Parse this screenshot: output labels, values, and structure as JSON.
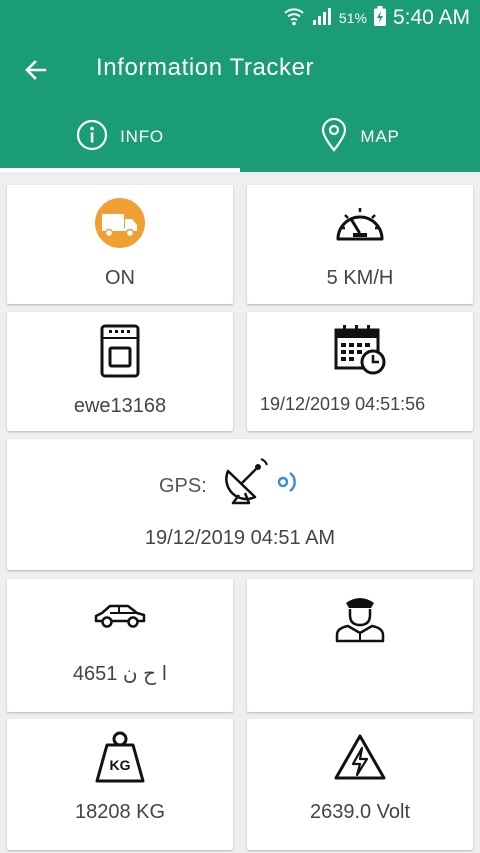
{
  "status_bar": {
    "battery_percent": "51%",
    "time": "5:40 AM",
    "icons": [
      "wifi-icon",
      "signal-icon",
      "battery-charging-icon"
    ]
  },
  "app_bar": {
    "title": "Information Tracker",
    "back_icon": "arrow-left-icon"
  },
  "tabs": [
    {
      "label": "INFO",
      "icon": "info-icon",
      "active": true
    },
    {
      "label": "MAP",
      "icon": "location-pin-icon",
      "active": false
    }
  ],
  "cards": {
    "engine_status": {
      "value": "ON",
      "icon": "truck-icon",
      "icon_color": "#f0a032"
    },
    "speed": {
      "value": "5 KM/H",
      "icon": "speedometer-icon"
    },
    "device_id": {
      "value": "ewe13168",
      "icon": "device-icon"
    },
    "last_update": {
      "value": "19/12/2019 04:51:56",
      "icon": "calendar-clock-icon"
    },
    "gps": {
      "label": "GPS:",
      "timestamp": "19/12/2019 04:51 AM",
      "icon": "satellite-dish-icon",
      "signal_icon": "gps-signal-icon",
      "signal_color": "#3a8fd8"
    },
    "plate": {
      "value": "4651 ا ح ن",
      "icon": "car-icon"
    },
    "driver": {
      "value": "",
      "icon": "driver-icon"
    },
    "weight": {
      "value": "18208 KG",
      "icon": "weight-icon",
      "icon_text": "KG"
    },
    "voltage": {
      "value": "2639.0 Volt",
      "icon": "high-voltage-icon"
    }
  },
  "colors": {
    "primary": "#1a9d74",
    "background": "#efefef",
    "text": "#444444"
  }
}
